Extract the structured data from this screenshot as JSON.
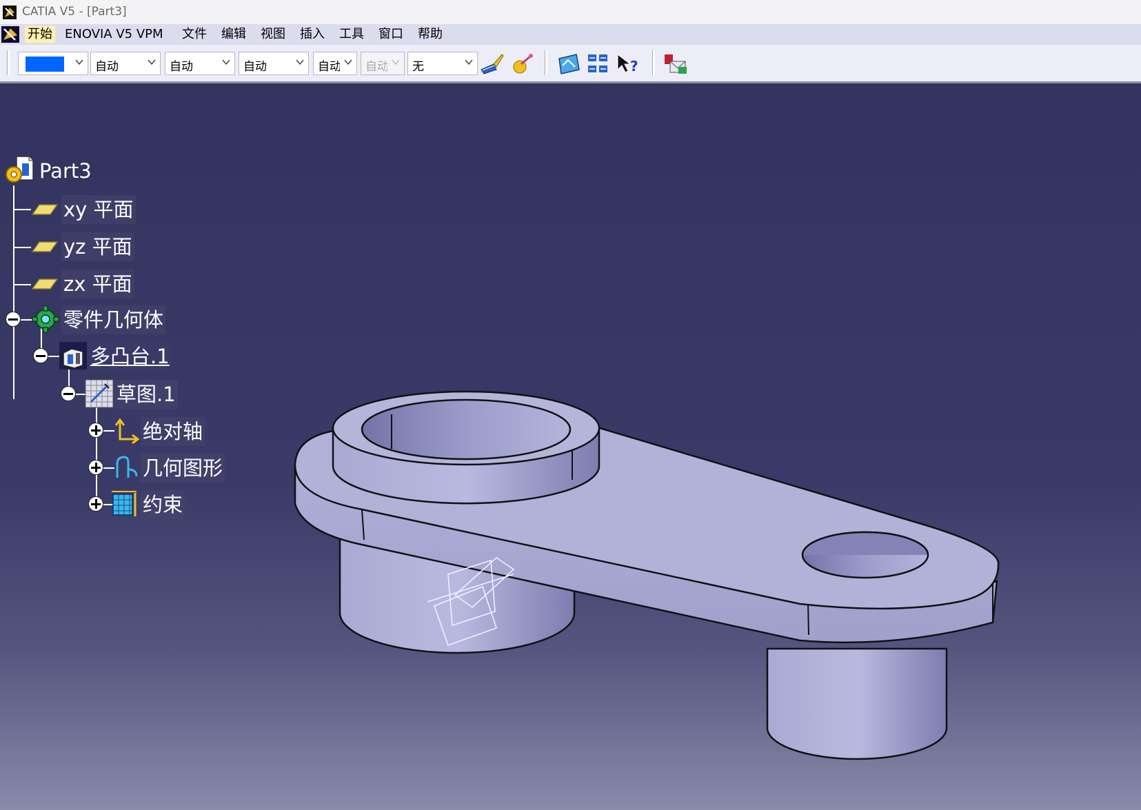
{
  "window": {
    "title": "CATIA V5 - [Part3]"
  },
  "menu": {
    "items": [
      "开始",
      "ENOVIA V5 VPM",
      "文件",
      "编辑",
      "视图",
      "插入",
      "工具",
      "窗口",
      "帮助"
    ],
    "active_index": 0
  },
  "toolbar": {
    "color_swatch": "#0066ff",
    "combos": [
      "自动",
      "自动",
      "自动",
      "自动",
      "自动",
      "无"
    ],
    "combos_short": [
      "自动",
      "自动",
      "自动",
      "自动",
      "自动",
      "无"
    ]
  },
  "tree": {
    "root": "Part3",
    "planes": [
      "xy 平面",
      "yz 平面",
      "zx 平面"
    ],
    "body": "零件几何体",
    "pad": "多凸台.1",
    "sketch": "草图.1",
    "sketch_children": [
      "绝对轴",
      "几何图形",
      "约束"
    ]
  },
  "colors": {
    "viewport_top": "#33335f",
    "viewport_bottom": "#8a8aab",
    "part_face": "#b1b1d6",
    "part_side": "#a3a3cc",
    "menu_highlight": "#fdf1b0"
  }
}
